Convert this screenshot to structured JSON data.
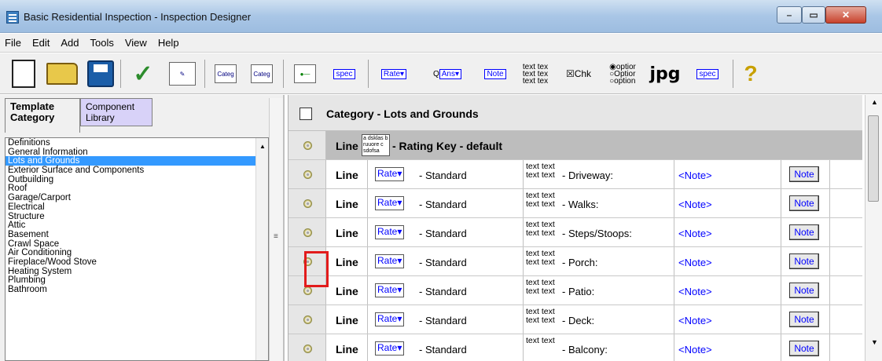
{
  "window": {
    "title": "Basic Residential Inspection - Inspection Designer"
  },
  "menu": [
    {
      "label": "File"
    },
    {
      "label": "Edit"
    },
    {
      "label": "Add"
    },
    {
      "label": "Tools"
    },
    {
      "label": "View"
    },
    {
      "label": "Help"
    }
  ],
  "toolbar": {
    "categ1": "Categ",
    "categ2": "Categ",
    "spec1": "spec",
    "rate": "Rate▾",
    "q": "Q",
    "ans": "Ans▾",
    "note": "Note",
    "text_lines": [
      "text tex",
      "text tex",
      "text tex"
    ],
    "chk": "☒Chk",
    "option_lines": [
      "◉optior",
      "○Optior",
      "○option"
    ],
    "jpg": "jpg",
    "spec2": "spec",
    "help": "?"
  },
  "left_panel": {
    "tab_template": "Template Category",
    "tab_component": "Component Library",
    "items": [
      "Definitions",
      "General Information",
      "Lots and Grounds",
      "Exterior Surface and Components",
      "Outbuilding",
      "Roof",
      "Garage/Carport",
      "Electrical",
      "Structure",
      "Attic",
      "Basement",
      "Crawl Space",
      "Air Conditioning",
      "Fireplace/Wood Stove",
      "Heating System",
      "Plumbing",
      "Bathroom"
    ],
    "selected_index": 2
  },
  "right_panel": {
    "category_title": "Category - Lots and Grounds",
    "key_row": {
      "line": "Line",
      "icon_text": "a dsklas b ruuore c sdofsa",
      "title": "- Rating Key - default"
    },
    "rows": [
      {
        "line": "Line",
        "rate": "Rate▾",
        "standard": "- Standard",
        "tt1": "text text",
        "tt2": "text text",
        "name": "- Driveway:",
        "note": "<Note>",
        "note_btn": "Note"
      },
      {
        "line": "Line",
        "rate": "Rate▾",
        "standard": "- Standard",
        "tt1": "text text",
        "tt2": "text text",
        "name": "- Walks:",
        "note": "<Note>",
        "note_btn": "Note"
      },
      {
        "line": "Line",
        "rate": "Rate▾",
        "standard": "- Standard",
        "tt1": "text text",
        "tt2": "text text",
        "name": "- Steps/Stoops:",
        "note": "<Note>",
        "note_btn": "Note"
      },
      {
        "line": "Line",
        "rate": "Rate▾",
        "standard": "- Standard",
        "tt1": "text text",
        "tt2": "text text",
        "name": "- Porch:",
        "note": "<Note>",
        "note_btn": "Note"
      },
      {
        "line": "Line",
        "rate": "Rate▾",
        "standard": "- Standard",
        "tt1": "text text",
        "tt2": "text text",
        "name": "- Patio:",
        "note": "<Note>",
        "note_btn": "Note"
      },
      {
        "line": "Line",
        "rate": "Rate▾",
        "standard": "- Standard",
        "tt1": "text text",
        "tt2": "text text",
        "name": "- Deck:",
        "note": "<Note>",
        "note_btn": "Note"
      },
      {
        "line": "Line",
        "rate": "Rate▾",
        "standard": "- Standard",
        "tt1": "text text",
        "tt2": "",
        "name": "- Balcony:",
        "note": "<Note>",
        "note_btn": "Note"
      }
    ]
  },
  "colors": {
    "selection": "#3399ff",
    "highlight": "#e21b1b",
    "link": "#0000ff"
  }
}
